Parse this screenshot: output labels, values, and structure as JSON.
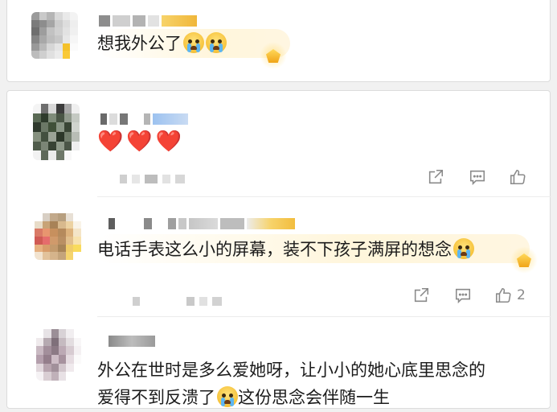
{
  "comments": [
    {
      "text": "想我外公了",
      "emojis": [
        "crying-face",
        "crying-face"
      ],
      "badge": "gold-badge"
    },
    {
      "text": "❤️❤️❤️",
      "actions": {
        "share": "",
        "comment": "",
        "like_count": ""
      }
    },
    {
      "text": "电话手表这么小的屏幕，装不下孩子满屏的想念",
      "emojis": [
        "crying-face"
      ],
      "badge": "gold-badge",
      "actions": {
        "share": "",
        "comment": "",
        "like_count": "2"
      }
    },
    {
      "text_line1": "外公在世时是多么爱她呀，让小小的她心底里思念的",
      "text_line2a": "爱得不到反溃了",
      "text_line2b": "这份思念会伴随一生",
      "emojis": [
        "crying-face"
      ]
    }
  ],
  "icons": {
    "share": "share-icon",
    "comment": "comment-icon",
    "like": "thumbs-up-icon"
  },
  "colors": {
    "background": "#f1f1f1",
    "card": "#ffffff",
    "heart": "#e6362e",
    "icon": "#8a8a8a"
  }
}
